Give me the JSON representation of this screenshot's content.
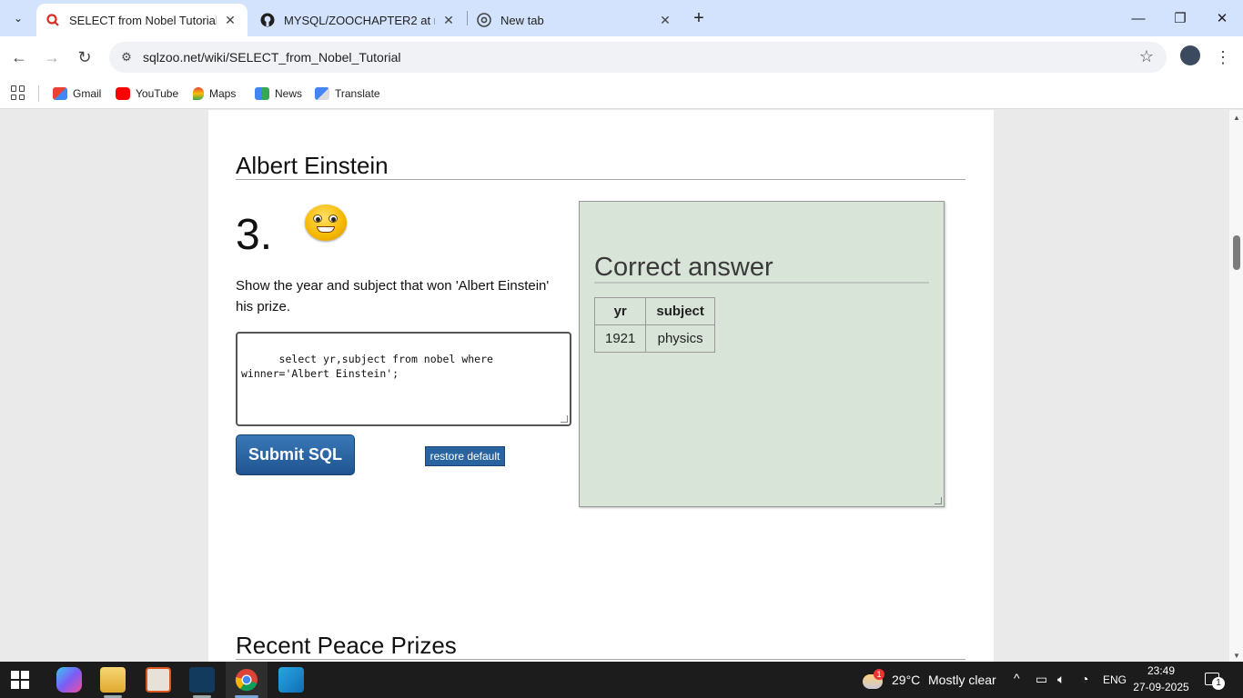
{
  "browser": {
    "tabs": [
      {
        "title": "SELECT from Nobel Tutorial - SQLZoo",
        "active": true
      },
      {
        "title": "MYSQL/ZOOCHAPTER2 at main",
        "active": false
      },
      {
        "title": "New tab",
        "active": false
      }
    ],
    "url": "sqlzoo.net/wiki/SELECT_from_Nobel_Tutorial",
    "bookmarks": [
      "Gmail",
      "YouTube",
      "Maps",
      "News",
      "Translate"
    ]
  },
  "page": {
    "section_heading": "Albert Einstein",
    "question_number": "3.",
    "question_text": "Show the year and subject that won 'Albert Einstein' his prize.",
    "sql": "select yr,subject from nobel where winner='Albert Einstein';",
    "submit_label": "Submit SQL",
    "restore_label": "restore default",
    "answer": {
      "title": "Correct answer",
      "columns": [
        "yr",
        "subject"
      ],
      "rows": [
        [
          "1921",
          "physics"
        ]
      ]
    },
    "next_heading": "Recent Peace Prizes"
  },
  "taskbar": {
    "weather_temp": "29°C",
    "weather_desc": "Mostly clear",
    "weather_badge": "1",
    "language": "ENG",
    "time": "23:49",
    "date": "27-09-2025",
    "notification_count": "1"
  }
}
